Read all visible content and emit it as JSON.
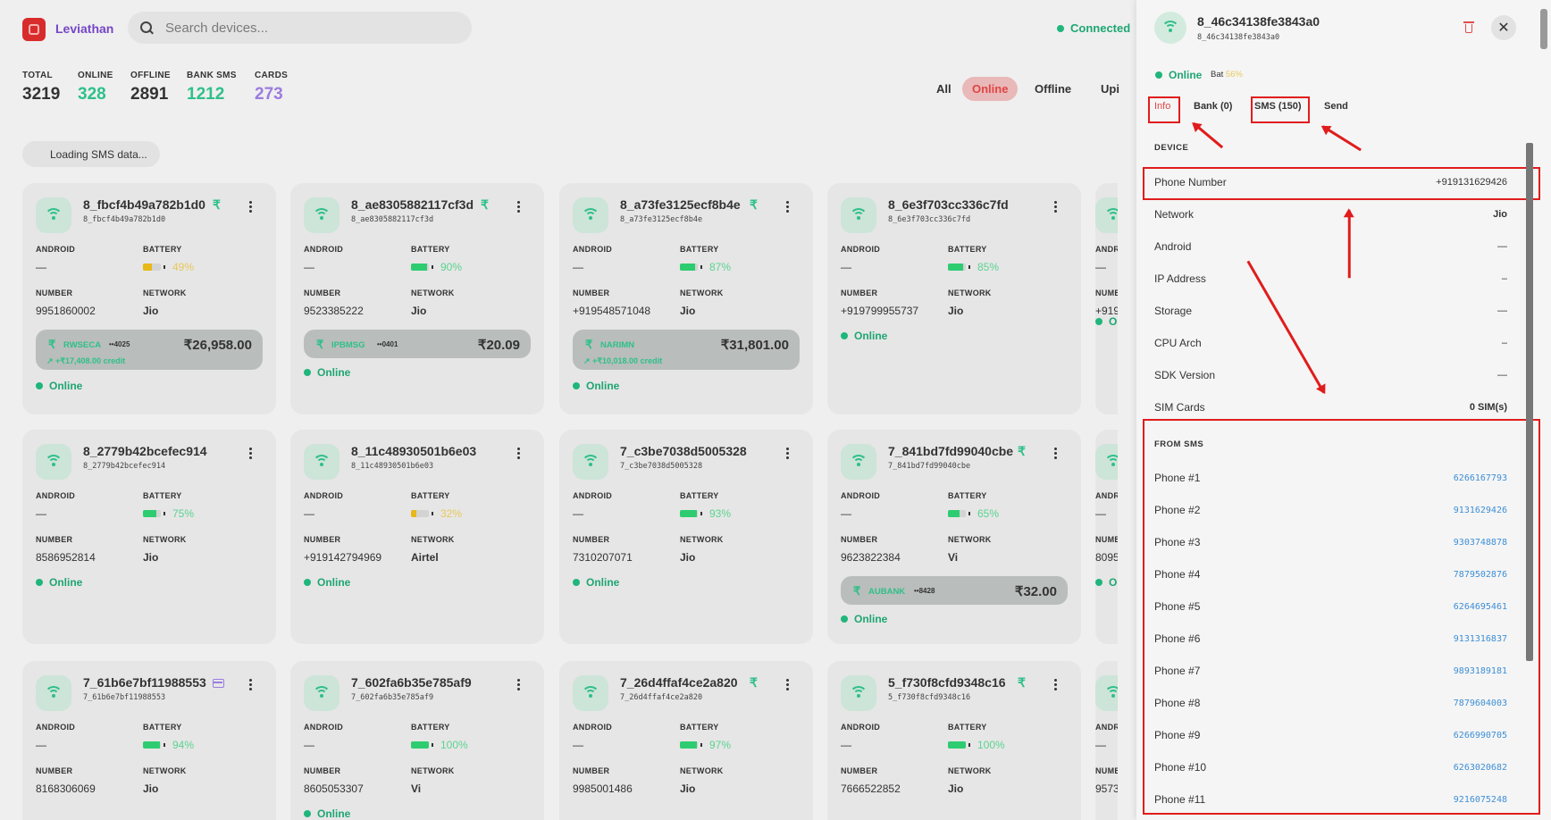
{
  "header": {
    "brand": "Leviathan",
    "search_placeholder": "Search devices...",
    "connection": "Connected"
  },
  "stats": [
    {
      "label": "TOTAL",
      "value": "3219",
      "color": "#333333"
    },
    {
      "label": "ONLINE",
      "value": "328",
      "color": "#2ec089"
    },
    {
      "label": "OFFLINE",
      "value": "2891",
      "color": "#333333"
    },
    {
      "label": "BANK SMS",
      "value": "1212",
      "color": "#2ec089"
    },
    {
      "label": "CARDS",
      "value": "273",
      "color": "#9b7ce0"
    }
  ],
  "filters": [
    "All",
    "Online",
    "Offline",
    "Upi"
  ],
  "loading_text": "Loading SMS data...",
  "labels": {
    "android": "ANDROID",
    "battery": "BATTERY",
    "number": "NUMBER",
    "network": "NETWORK"
  },
  "cards": [
    {
      "title": "8_fbcf4b49a782b1d0",
      "sub": "8_fbcf4b49a782b1d0",
      "android": "—",
      "battery": "49%",
      "battery_level": 0.49,
      "battery_color": "#e8b818",
      "number": "9951860002",
      "network": "Jio",
      "status": "Online",
      "badge": "rupee",
      "bank": {
        "name": "RWSECA",
        "acc": "••4025",
        "amount": "₹26,958.00",
        "credit": "+₹17,408.00 credit"
      }
    },
    {
      "title": "8_ae8305882117cf3d",
      "sub": "8_ae8305882117cf3d",
      "android": "—",
      "battery": "90%",
      "battery_level": 0.9,
      "battery_color": "#2ecc71",
      "number": "9523385222",
      "network": "Jio",
      "status": "Online",
      "badge": "rupee",
      "bank": {
        "name": "IPBMSG",
        "acc": "••0401",
        "amount": "₹20.09",
        "credit": ""
      }
    },
    {
      "title": "8_a73fe3125ecf8b4e",
      "sub": "8_a73fe3125ecf8b4e",
      "android": "—",
      "battery": "87%",
      "battery_level": 0.87,
      "battery_color": "#2ecc71",
      "number": "+919548571048",
      "network": "Jio",
      "status": "Online",
      "badge": "rupee",
      "bank": {
        "name": "NARIMN",
        "acc": "",
        "amount": "₹31,801.00",
        "credit": "+₹10,018.00 credit"
      }
    },
    {
      "title": "8_6e3f703cc336c7fd",
      "sub": "8_6e3f703cc336c7fd",
      "android": "—",
      "battery": "85%",
      "battery_level": 0.85,
      "battery_color": "#2ecc71",
      "number": "+919799955737",
      "network": "Jio",
      "status": "Online",
      "badge": "",
      "bank": null
    },
    {
      "title": "8_2779b42bcefec914",
      "sub": "8_2779b42bcefec914",
      "android": "—",
      "battery": "75%",
      "battery_level": 0.75,
      "battery_color": "#2ecc71",
      "number": "8586952814",
      "network": "Jio",
      "status": "Online",
      "badge": "",
      "bank": null
    },
    {
      "title": "8_11c48930501b6e03",
      "sub": "8_11c48930501b6e03",
      "android": "—",
      "battery": "32%",
      "battery_level": 0.32,
      "battery_color": "#e8b818",
      "number": "+919142794969",
      "network": "Airtel",
      "status": "Online",
      "badge": "",
      "bank": null
    },
    {
      "title": "7_c3be7038d5005328",
      "sub": "7_c3be7038d5005328",
      "android": "—",
      "battery": "93%",
      "battery_level": 0.93,
      "battery_color": "#2ecc71",
      "number": "7310207071",
      "network": "Jio",
      "status": "Online",
      "badge": "",
      "bank": null
    },
    {
      "title": "7_841bd7fd99040cbe",
      "sub": "7_841bd7fd99040cbe",
      "android": "—",
      "battery": "65%",
      "battery_level": 0.65,
      "battery_color": "#2ecc71",
      "number": "9623822384",
      "network": "Vi",
      "status": "Online",
      "badge": "rupee",
      "bank": {
        "name": "AUBANK",
        "acc": "••8428",
        "amount": "₹32.00",
        "credit": ""
      }
    },
    {
      "title": "7_61b6e7bf11988553",
      "sub": "7_61b6e7bf11988553",
      "android": "—",
      "battery": "94%",
      "battery_level": 0.94,
      "battery_color": "#2ecc71",
      "number": "8168306069",
      "network": "Jio",
      "status": "",
      "badge": "card",
      "bank": null
    },
    {
      "title": "7_602fa6b35e785af9",
      "sub": "7_602fa6b35e785af9",
      "android": "—",
      "battery": "100%",
      "battery_level": 1.0,
      "battery_color": "#2ecc71",
      "number": "8605053307",
      "network": "Vi",
      "status": "Online",
      "badge": "",
      "bank": null
    },
    {
      "title": "7_26d4ffaf4ce2a820",
      "sub": "7_26d4ffaf4ce2a820",
      "android": "—",
      "battery": "97%",
      "battery_level": 0.97,
      "battery_color": "#2ecc71",
      "number": "9985001486",
      "network": "Jio",
      "status": "",
      "badge": "rupee",
      "bank": null
    },
    {
      "title": "5_f730f8cfd9348c16",
      "sub": "5_f730f8cfd9348c16",
      "android": "—",
      "battery": "100%",
      "battery_level": 1.0,
      "battery_color": "#2ecc71",
      "number": "7666522852",
      "network": "Jio",
      "status": "",
      "badge": "rupee",
      "bank": null
    }
  ],
  "peek_numbers": [
    "+919",
    "8095",
    "9573"
  ],
  "peek_status": "On",
  "peek_partial_label": "NUMB",
  "panel": {
    "title": "8_46c34138fe3843a0",
    "sub": "8_46c34138fe3843a0",
    "status": "Online",
    "bat_label": "Bat",
    "bat_value": "56%",
    "tabs": [
      "Info",
      "Bank (0)",
      "SMS (150)",
      "Send"
    ],
    "device_heading": "DEVICE",
    "device_rows": [
      {
        "k": "Phone Number",
        "v": "+919131629426"
      },
      {
        "k": "Network",
        "v": "Jio"
      },
      {
        "k": "Android",
        "v": "—"
      },
      {
        "k": "IP Address",
        "v": "–"
      },
      {
        "k": "Storage",
        "v": "—"
      },
      {
        "k": "CPU Arch",
        "v": "–"
      },
      {
        "k": "SDK Version",
        "v": "—"
      },
      {
        "k": "SIM Cards",
        "v": "0 SIM(s)"
      }
    ],
    "from_sms_heading": "FROM SMS",
    "sms_rows": [
      {
        "k": "Phone #1",
        "v": "6266167793"
      },
      {
        "k": "Phone #2",
        "v": "9131629426"
      },
      {
        "k": "Phone #3",
        "v": "9303748878"
      },
      {
        "k": "Phone #4",
        "v": "7879502876"
      },
      {
        "k": "Phone #5",
        "v": "6264695461"
      },
      {
        "k": "Phone #6",
        "v": "9131316837"
      },
      {
        "k": "Phone #7",
        "v": "9893189181"
      },
      {
        "k": "Phone #8",
        "v": "7879604003"
      },
      {
        "k": "Phone #9",
        "v": "6266990705"
      },
      {
        "k": "Phone #10",
        "v": "6263020682"
      },
      {
        "k": "Phone #11",
        "v": "9216075248"
      }
    ]
  }
}
